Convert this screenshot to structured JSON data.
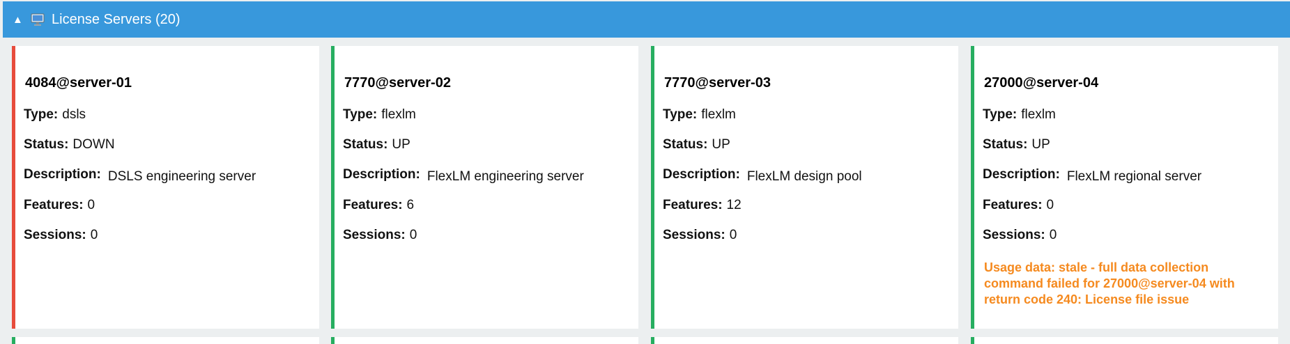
{
  "header": {
    "toggle_icon": "triangle-up",
    "icon": "computer-monitor-icon",
    "title": "License Servers (20)",
    "color": "#3898dc"
  },
  "labels": {
    "type": "Type:",
    "status": "Status:",
    "description": "Description:",
    "features": "Features:",
    "sessions": "Sessions:"
  },
  "servers": [
    {
      "name": "4084@server-01",
      "type": "dsls",
      "status": "DOWN",
      "description": "DSLS engineering server",
      "features": "0",
      "sessions": "0",
      "accent": "#e74c3c"
    },
    {
      "name": "7770@server-02",
      "type": "flexlm",
      "status": "UP",
      "description": "FlexLM engineering server",
      "features": "6",
      "sessions": "0",
      "accent": "#27ae60"
    },
    {
      "name": "7770@server-03",
      "type": "flexlm",
      "status": "UP",
      "description": "FlexLM design pool",
      "features": "12",
      "sessions": "0",
      "accent": "#27ae60"
    },
    {
      "name": "27000@server-04",
      "type": "flexlm",
      "status": "UP",
      "description": "FlexLM regional server",
      "features": "0",
      "sessions": "0",
      "accent": "#27ae60",
      "warning": "Usage data: stale - full data collection command failed for 27000@server-04 with return code 240: License file issue",
      "warning_color": "#f58a1f"
    }
  ]
}
